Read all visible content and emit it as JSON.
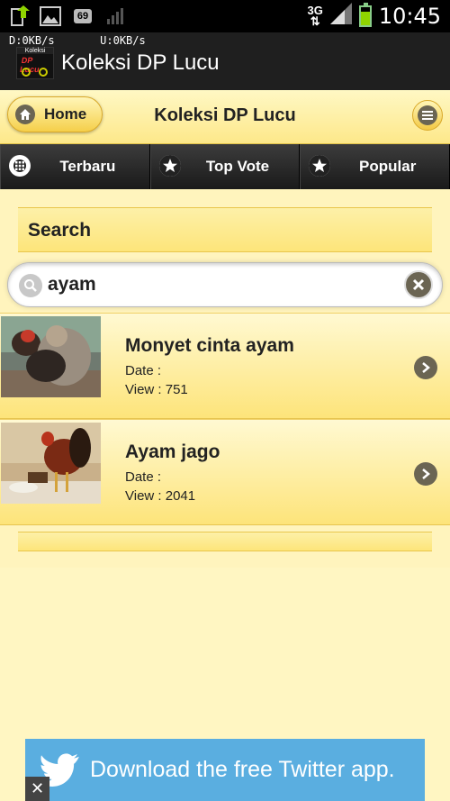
{
  "status_bar": {
    "time": "10:45",
    "network": "3G",
    "notification_count": "69"
  },
  "app_bar": {
    "net_speed": "D:0KB/s       U:0KB/s",
    "logo_top_text": "Koleksi",
    "logo_main_text": "DP Lucu",
    "title": "Koleksi DP Lucu"
  },
  "header": {
    "home_label": "Home",
    "title": "Koleksi DP Lucu"
  },
  "navbar": {
    "items": [
      {
        "label": "Terbaru",
        "icon": "grid-icon"
      },
      {
        "label": "Top Vote",
        "icon": "star-icon"
      },
      {
        "label": "Popular",
        "icon": "star-icon"
      }
    ]
  },
  "search": {
    "label": "Search",
    "value": "ayam"
  },
  "results": [
    {
      "title": "Monyet cinta ayam",
      "date": "Date :",
      "view": "View : 751"
    },
    {
      "title": "Ayam jago",
      "date": "Date :",
      "view": "View : 2041"
    }
  ],
  "ad": {
    "text": "Download the free Twitter app.",
    "close": "✕"
  },
  "colors": {
    "accent_yellow": "#fde57a",
    "icon_dark": "#6b6553",
    "twitter_blue": "#5aaee0"
  }
}
